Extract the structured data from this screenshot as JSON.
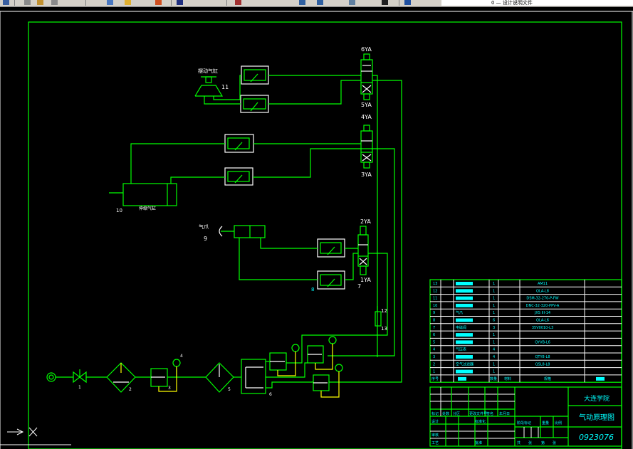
{
  "toolbar": {
    "layer_name": "0 — 设计说明文件"
  },
  "colors": {
    "background": "#000000",
    "lines": "#00ff00",
    "table_text": "#00ffff",
    "labels": "#ffffff",
    "pilot_lines": "#ffff00"
  },
  "diagram": {
    "solenoids": [
      "6YA",
      "5YA",
      "4YA",
      "3YA",
      "2YA",
      "1YA"
    ],
    "swing_cylinder": {
      "label": "摆动气缸",
      "number": "11"
    },
    "telescopic_cylinder": {
      "label": "伸缩气缸",
      "number": "10"
    },
    "gripper": {
      "label": "气爪",
      "number": "9"
    },
    "numbers": {
      "valve": "1",
      "filter": "2",
      "regulator": "3",
      "gauge": "4",
      "lubricator": "5",
      "manifold": "6",
      "directional_valve": "7",
      "flow_control": "8",
      "silencer": "12",
      "tank": "13"
    }
  },
  "parts_list": {
    "rows": [
      {
        "no": "13",
        "qty": "1",
        "model": "AM11"
      },
      {
        "no": "12",
        "qty": "1",
        "model": "QLA-L8"
      },
      {
        "no": "11",
        "qty": "1",
        "model": "DSM-32-270-P-FW"
      },
      {
        "no": "10",
        "qty": "1",
        "model": "DNC-32-320-PPV-A"
      },
      {
        "no": "9",
        "name": "气爪",
        "qty": "1",
        "model": "JXS III-14"
      },
      {
        "no": "8",
        "qty": "6",
        "model": "QLA-L6"
      },
      {
        "no": "7",
        "name": "电磁阀",
        "qty": "3",
        "model": "35V0010-L3"
      },
      {
        "no": "6",
        "qty": "1",
        "model": ""
      },
      {
        "no": "5",
        "qty": "1",
        "model": "QYVB-L6"
      },
      {
        "no": "4",
        "name": "气压表",
        "qty": "4",
        "model": ""
      },
      {
        "no": "3",
        "qty": "4",
        "model": "QTY8-L8"
      },
      {
        "no": "2",
        "name": "空气过滤器",
        "qty": "1",
        "model": "QSL8-L8"
      },
      {
        "no": "1",
        "qty": "1",
        "model": ""
      }
    ],
    "header": {
      "no": "序号",
      "qty": "数量",
      "material": "材料",
      "spec": "规格"
    }
  },
  "title_block": {
    "school": "大连学院",
    "drawing_title": "气动原理图",
    "drawing_number": "0923076",
    "labels": [
      "标记",
      "处数",
      "分区",
      "更改文件号",
      "签名",
      "年月日",
      "设计",
      "标准化",
      "审核",
      "工艺",
      "批准",
      "阶段标记",
      "重量",
      "比例",
      "共",
      "张",
      "第",
      "张"
    ]
  }
}
